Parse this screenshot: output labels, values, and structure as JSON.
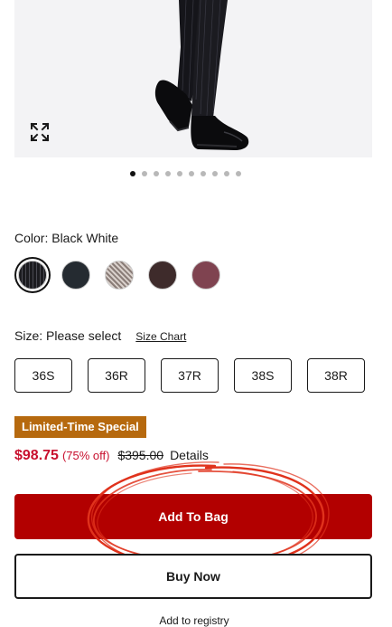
{
  "product_image": {
    "alt": "model wearing black pinstripe suit pants and black leather shoes",
    "expand_icon": "expand-arrows-icon",
    "carousel_dot_count": 10,
    "carousel_active_index": 0
  },
  "color": {
    "label": "Color: Black White",
    "swatches": [
      {
        "name": "Black White",
        "color": "#1b1b1f",
        "selected": true
      },
      {
        "name": "Navy",
        "color": "#252b31",
        "selected": false
      },
      {
        "name": "Houndstooth",
        "color": "#b7aaa5",
        "selected": false
      },
      {
        "name": "Brown",
        "color": "#3e2b2b",
        "selected": false
      },
      {
        "name": "Burgundy",
        "color": "#7f4350",
        "selected": false
      }
    ]
  },
  "size": {
    "label": "Size: Please select",
    "chart_link": "Size Chart",
    "options": [
      "36S",
      "36R",
      "37R",
      "38S",
      "38R"
    ]
  },
  "promo": {
    "label": "Limited-Time Special",
    "color": "#b6690e"
  },
  "price": {
    "sale": "$98.75",
    "discount": "(75% off)",
    "original": "$395.00",
    "details_link": "Details",
    "sale_color": "#c8102e"
  },
  "actions": {
    "add_to_bag": "Add To Bag",
    "buy_now": "Buy Now",
    "add_to_registry": "Add to registry",
    "primary_color": "#b20000"
  }
}
